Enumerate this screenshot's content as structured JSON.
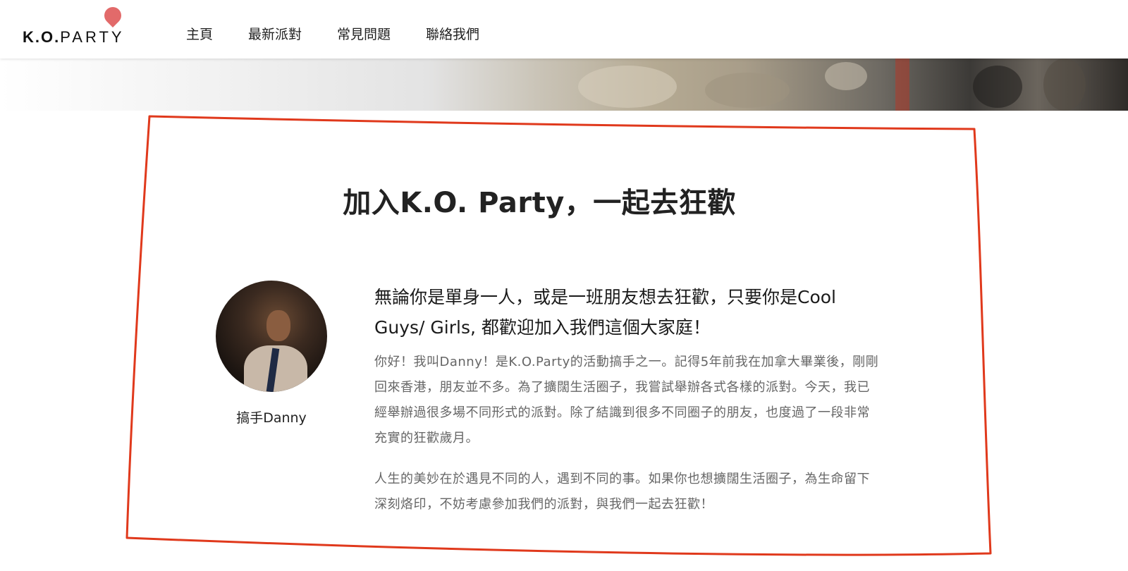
{
  "header": {
    "logo": {
      "text_bold": "K.O.",
      "text_light": "PARTY"
    },
    "nav": [
      {
        "label": "主頁"
      },
      {
        "label": "最新派對"
      },
      {
        "label": "常見問題"
      },
      {
        "label": "聯絡我們"
      }
    ]
  },
  "colors": {
    "accent": "#e26a6a",
    "annotation": "#e0391c"
  },
  "section": {
    "title": "加入K.O. Party，一起去狂歡",
    "profile": {
      "caption": "搞手Danny"
    },
    "lead": "無論你是單身一人，或是一班朋友想去狂歡，只要你是Cool Guys/ Girls, 都歡迎加入我們這個大家庭！",
    "paragraphs": [
      "你好！我叫Danny！是K.O.Party的活動搞手之一。記得5年前我在加拿大畢業後，剛剛回來香港，朋友並不多。為了擴闊生活圈子，我嘗試舉辦各式各樣的派對。今天，我已經舉辦過很多場不同形式的派對。除了結識到很多不同圈子的朋友，也度過了一段非常充實的狂歡歲月。",
      "人生的美妙在於遇見不同的人，遇到不同的事。如果你也想擴闊生活圈子，為生命留下深刻烙印，不妨考慮參加我們的派對，與我們一起去狂歡！"
    ]
  }
}
